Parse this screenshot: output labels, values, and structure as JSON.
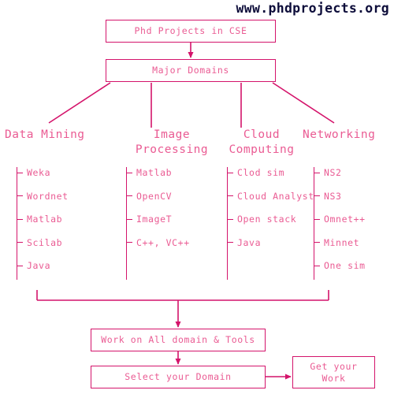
{
  "header": {
    "site_url": "www.phdprojects.org",
    "url_color": "#0d0d3a"
  },
  "theme": {
    "border_color": "#d4146b",
    "text_color": "#ea5b93",
    "background": "#ffffff"
  },
  "flow": {
    "root_label": "Phd Projects in CSE",
    "major_label": "Major Domains",
    "work_label": "Work on All domain & Tools",
    "select_label": "Select your Domain",
    "get_label": "Get your\nWork"
  },
  "columns": [
    {
      "title": "Data Mining",
      "items": [
        "Weka",
        "Wordnet",
        "Matlab",
        "Scilab",
        "Java"
      ]
    },
    {
      "title": "Image\nProcessing",
      "items": [
        "Matlab",
        "OpenCV",
        "ImageT",
        "C++, VC++"
      ]
    },
    {
      "title": "Cloud\nComputing",
      "items": [
        "Clod sim",
        "Cloud Analyst",
        "Open stack",
        "Java"
      ]
    },
    {
      "title": "Networking",
      "items": [
        "NS2",
        "NS3",
        "Omnet++",
        "Minnet",
        "One sim"
      ]
    }
  ]
}
